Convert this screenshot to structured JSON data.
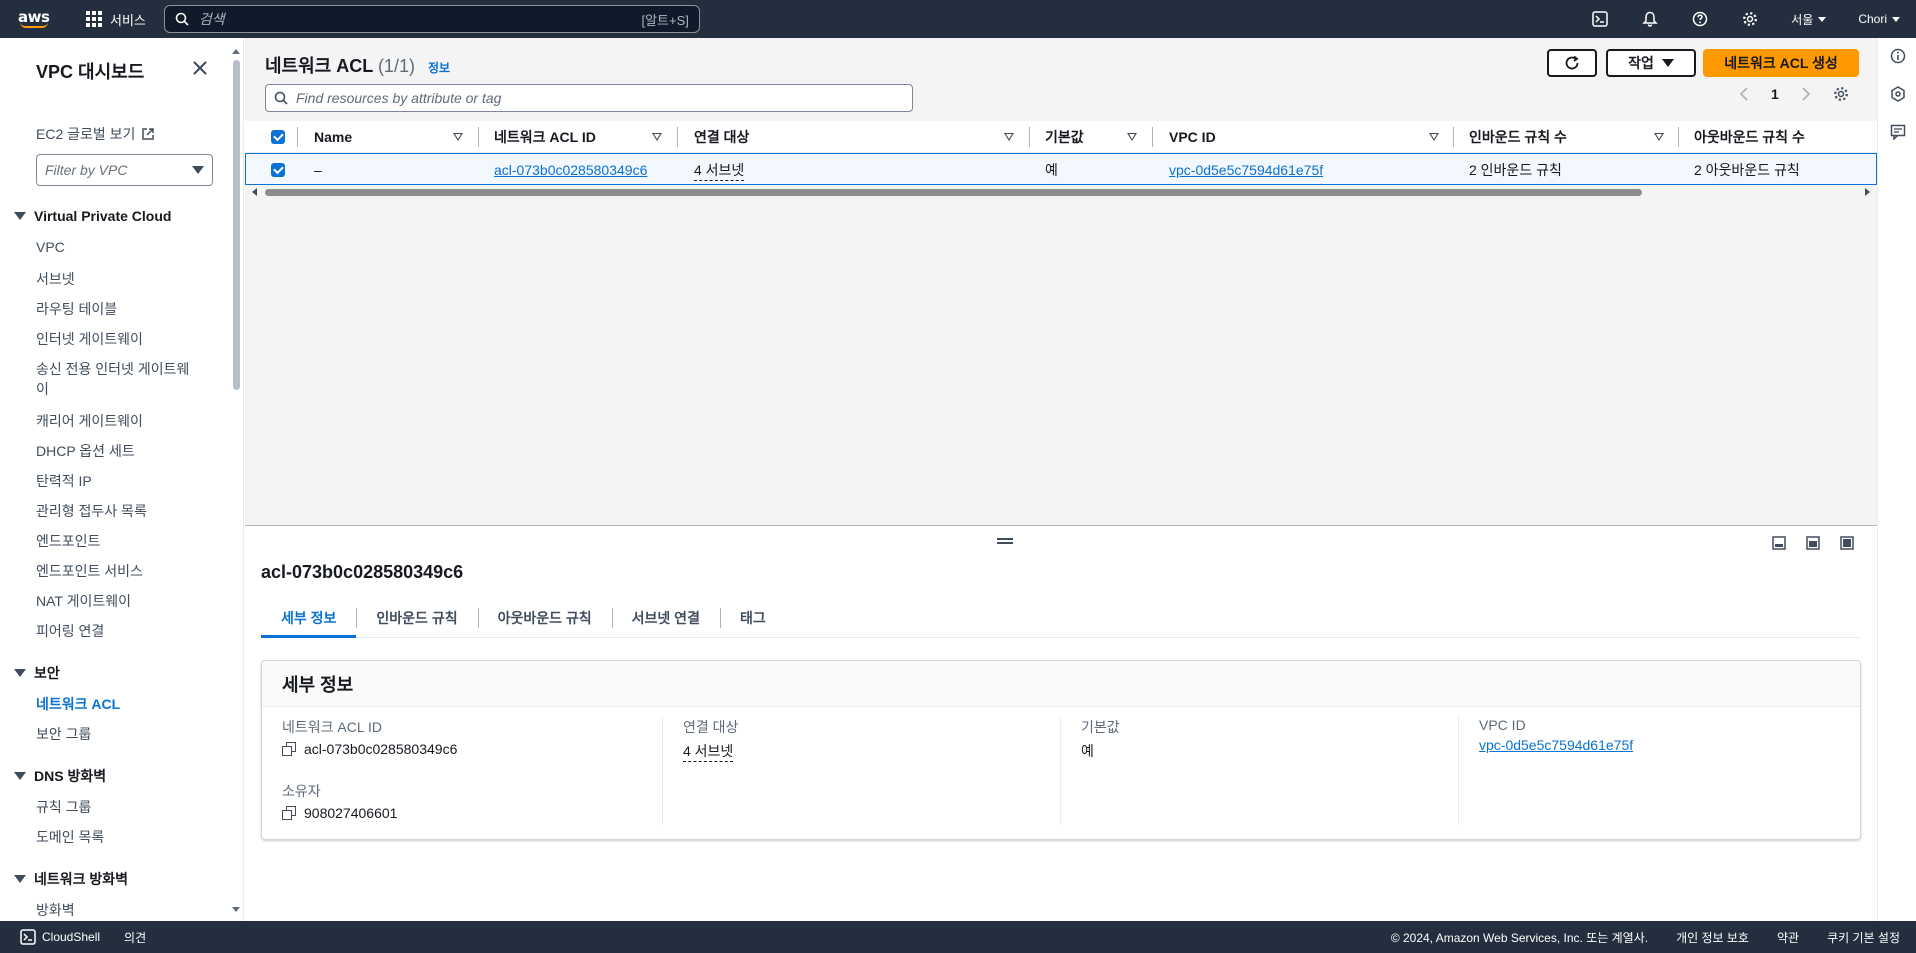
{
  "topnav": {
    "logo": "aws",
    "services_label": "서비스",
    "search_placeholder": "검색",
    "search_shortcut": "[알트+S]",
    "region": "서울",
    "account": "Chori",
    "icons": [
      "cloudshell-icon",
      "bell-icon",
      "help-icon",
      "gear-icon"
    ]
  },
  "sidebar": {
    "title": "VPC 대시보드",
    "global_view": "EC2 글로벌 보기",
    "filter_placeholder": "Filter by VPC",
    "sections": [
      {
        "label": "Virtual Private Cloud",
        "items": [
          "VPC",
          "서브넷",
          "라우팅 테이블",
          "인터넷 게이트웨이",
          "송신 전용 인터넷 게이트웨",
          "이",
          "캐리어 게이트웨이",
          "DHCP 옵션 세트",
          "탄력적 IP",
          "관리형 접두사 목록",
          "엔드포인트",
          "엔드포인트 서비스",
          "NAT 게이트웨이",
          "피어링 연결"
        ]
      },
      {
        "label": "보안",
        "items": [
          "네트워크 ACL",
          "보안 그룹"
        ]
      },
      {
        "label": "DNS 방화벽",
        "items": [
          "규칙 그룹",
          "도메인 목록"
        ]
      },
      {
        "label": "네트워크 방화벽",
        "items": [
          "방화벽"
        ]
      }
    ]
  },
  "header": {
    "title": "네트워크 ACL",
    "count": "(1/1)",
    "info": "정보",
    "actions_label": "작업",
    "create_label": "네트워크 ACL 생성",
    "find_placeholder": "Find resources by attribute or tag",
    "page": "1"
  },
  "table": {
    "columns": [
      "Name",
      "네트워크 ACL ID",
      "연결 대상",
      "기본값",
      "VPC ID",
      "인바운드 규칙 수",
      "아웃바운드 규칙 수"
    ],
    "rows": [
      {
        "selected": true,
        "name": "–",
        "acl_id": "acl-073b0c028580349c6",
        "associated": "4 서브넷",
        "default": "예",
        "vpc_id": "vpc-0d5e5c7594d61e75f",
        "inbound": "2 인바운드 규칙",
        "outbound": "2 아웃바운드 규칙"
      }
    ]
  },
  "split_panel": {
    "title": "acl-073b0c028580349c6",
    "tabs": [
      "세부 정보",
      "인바운드 규칙",
      "아웃바운드 규칙",
      "서브넷 연결",
      "태그"
    ],
    "active_tab": "세부 정보",
    "details_title": "세부 정보",
    "fields": {
      "acl_id_label": "네트워크 ACL ID",
      "acl_id_value": "acl-073b0c028580349c6",
      "owner_label": "소유자",
      "owner_value": "908027406601",
      "associated_label": "연결 대상",
      "associated_value": "4 서브넷",
      "default_label": "기본값",
      "default_value": "예",
      "vpc_label": "VPC ID",
      "vpc_value": "vpc-0d5e5c7594d61e75f"
    }
  },
  "footer": {
    "cloudshell": "CloudShell",
    "feedback": "의견",
    "copyright": "© 2024, Amazon Web Services, Inc. 또는 계열사.",
    "privacy": "개인 정보 보호",
    "terms": "약관",
    "cookies": "쿠키 기본 설정"
  },
  "colors": {
    "nav_bg": "#232f3e",
    "primary": "#ff9900",
    "link": "#0972d3"
  }
}
